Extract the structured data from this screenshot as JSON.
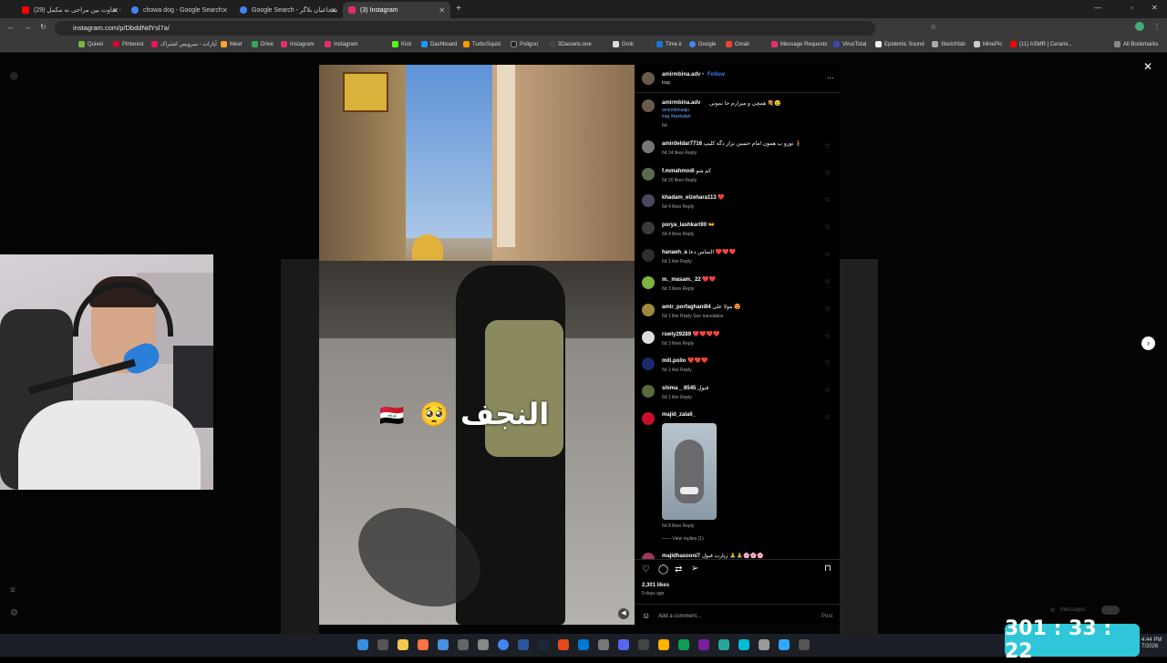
{
  "tabs": [
    {
      "title": "(29) تفاوت بین مراحی نه مکمل -",
      "icon_color": "#ff0000"
    },
    {
      "title": "chowa dog - Google Search",
      "icon_color": "#4285f4"
    },
    {
      "title": "Google Search - شجاعیان بلاگر",
      "icon_color": "#4285f4"
    },
    {
      "title": "(3) Instagram",
      "icon_color": "#e1306c",
      "active": true
    }
  ],
  "address": "instagram.com/p/DbddNdYsl7a/",
  "bookmarks": [
    "Quixel",
    "Pinterest",
    "آپارات - سرویس اشتراک",
    "Meet",
    "Drive",
    "Instagram",
    "Instagram",
    "Kick",
    "Dashboard",
    "TurboSquid",
    "Poligon",
    "3Dassets.one",
    "Grok",
    "Time.ir",
    "Google",
    "Gmail",
    "Message Requests",
    "VirusTotal",
    "Epidemic Sound",
    "Sketchfab",
    "MinePic",
    "(11) ASMR | Cerami...",
    "All Bookmarks"
  ],
  "post": {
    "author": "amirmbina.adv",
    "follow": "Follow",
    "location": "Iraq",
    "caption": "همچی و میزارم جا نمونی 💐😢",
    "caption_tags": [
      "amirmbinaajo",
      "iraq #karbala#"
    ],
    "caption_age": "6d",
    "video_text": "النجف",
    "likes": "2,301 likes",
    "posted": "9 days ago",
    "add_comment_placeholder": "Add a comment...",
    "post_label": "Post"
  },
  "comments": [
    {
      "user": "amirdeldar7716",
      "text": "تورو ب همون امام حسین نزار دگه کلیپ 🧎",
      "meta": "6d  24 likes  Reply"
    },
    {
      "user": "f.mmahmodi",
      "text": "کم شو",
      "meta": "6d  20 likes  Reply"
    },
    {
      "user": "khadam_elzehara113",
      "text": "❤️",
      "meta": "6d  4 likes  Reply"
    },
    {
      "user": "porya_lashkari90",
      "text": "👐",
      "meta": "6d  4 likes  Reply"
    },
    {
      "user": "hanaeh_a",
      "text": "التماس دعا ❤️❤️❤️",
      "meta": "6d  1 like  Reply"
    },
    {
      "user": "m._masam._22",
      "text": "❤️❤️",
      "meta": "6d  3 likes  Reply"
    },
    {
      "user": "amir_porfaghani84",
      "text": "مولا علی 😍",
      "meta": "6d  1 like  Reply  See translation"
    },
    {
      "user": "rswly29289",
      "text": "❤️❤️❤️❤️",
      "meta": "6d  3 likes  Reply"
    },
    {
      "user": "mili.pollo",
      "text": "❤️❤️❤️",
      "meta": "6d  1 like  Reply"
    },
    {
      "user": "shima__6545",
      "text": "قبول",
      "meta": "6d  1 like  Reply"
    },
    {
      "user": "majid_zalali_",
      "text": "",
      "meta": "6d  8 likes  Reply"
    },
    {
      "user": "majidhasooni7",
      "text": "زیارت قبول 🙏🙏🌸🌸🌸",
      "meta": ""
    }
  ],
  "view_replies": "View replies (1)",
  "timer": "301 : 33 : 22",
  "clock": {
    "time": "4:44 PM",
    "date": "7/2026"
  },
  "messages_label": "Messages"
}
